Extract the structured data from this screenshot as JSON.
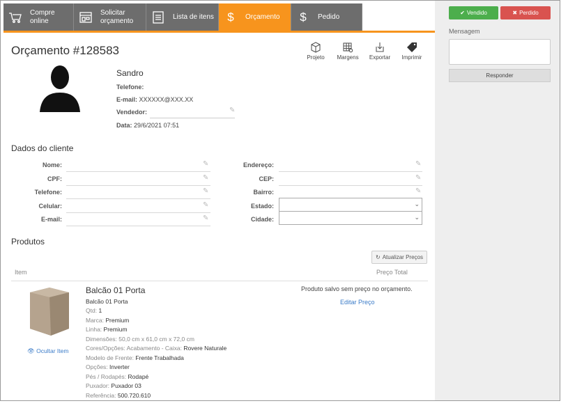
{
  "tabs": [
    {
      "line1": "Compre",
      "line2": "online",
      "icon": "cart-icon"
    },
    {
      "line1": "Solicitar",
      "line2": "orçamento",
      "icon": "store-icon"
    },
    {
      "line1": "Lista de itens",
      "line2": "",
      "icon": "list-icon"
    },
    {
      "line1": "Orçamento",
      "line2": "",
      "icon": "dollar-icon",
      "active": true
    },
    {
      "line1": "Pedido",
      "line2": "",
      "icon": "dollar-icon"
    }
  ],
  "page": {
    "title": "Orçamento #128583"
  },
  "tools": {
    "projeto": "Projeto",
    "margens": "Margens",
    "exportar": "Exportar",
    "imprimir": "Imprimir"
  },
  "client": {
    "name": "Sandro",
    "telefone_label": "Telefone:",
    "email_label": "E-mail:",
    "email_value": "XXXXXX@XXX.XX",
    "vendedor_label": "Vendedor:",
    "data_label": "Data:",
    "data_value": "29/6/2021 07:51"
  },
  "dados": {
    "title": "Dados do cliente",
    "nome": "Nome:",
    "cpf": "CPF:",
    "telefone": "Telefone:",
    "celular": "Celular:",
    "email": "E-mail:",
    "endereco": "Endereço:",
    "cep": "CEP:",
    "bairro": "Bairro:",
    "estado": "Estado:",
    "cidade": "Cidade:"
  },
  "produtos": {
    "title": "Produtos",
    "refresh_button": "Atualizar Preços",
    "col_item": "Item",
    "col_price": "Preço Total",
    "item": {
      "name": "Balcão 01 Porta",
      "subtitle": "Balcão 01 Porta",
      "qtd_label": "Qtd:",
      "qtd": "1",
      "marca_label": "Marca:",
      "marca": "Premium",
      "linha_label": "Linha:",
      "linha": "Premium",
      "dim_label": "Dimensões:",
      "dim": "50,0 cm x 61,0 cm x 72,0 cm",
      "cores_label": "Cores/Opções:",
      "cores_sub": "Acabamento - Caixa:",
      "cores": "Rovere Naturale",
      "modelo_label": "Modelo de Frente:",
      "modelo": "Frente Trabalhada",
      "opcoes_label": "Opções:",
      "opcoes": "Inverter",
      "pes_label": "Pés / Rodapés:",
      "pes": "Rodapé",
      "puxador_label": "Puxador:",
      "puxador": "Puxador 03",
      "ref_label": "Referência:",
      "ref": "500.720.610",
      "hide_link": "Ocultar Item",
      "price_msg": "Produto salvo sem preço no orçamento.",
      "edit_price": "Editar Preço"
    }
  },
  "sidebar": {
    "vendido": "Vendido",
    "perdido": "Perdido",
    "mensagem_label": "Mensagem",
    "responder": "Responder"
  },
  "colors": {
    "accent": "#f7941d",
    "tab_bg": "#6d6d6d",
    "sold": "#4cae4c",
    "lost": "#d9534f",
    "link": "#3a7bc8"
  }
}
